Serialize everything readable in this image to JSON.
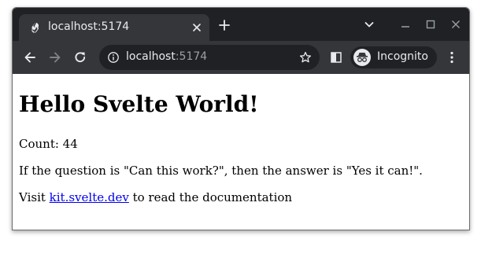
{
  "browser": {
    "tab": {
      "title": "localhost:5174",
      "favicon": "svelte-icon"
    },
    "address_bar": {
      "host": "localhost",
      "port": ":5174"
    },
    "profile": {
      "label": "Incognito"
    },
    "colors": {
      "frame": "#202124",
      "toolbar": "#35363a",
      "text": "#e8eaed",
      "muted": "#9aa0a6"
    }
  },
  "page": {
    "heading": "Hello Svelte World!",
    "count_label": "Count: 44",
    "question_text": "If the question is \"Can this work?\", then the answer is \"Yes it can!\".",
    "visit_prefix": "Visit ",
    "link_text": "kit.svelte.dev",
    "visit_suffix": " to read the documentation",
    "link_color": "#0000ee"
  }
}
